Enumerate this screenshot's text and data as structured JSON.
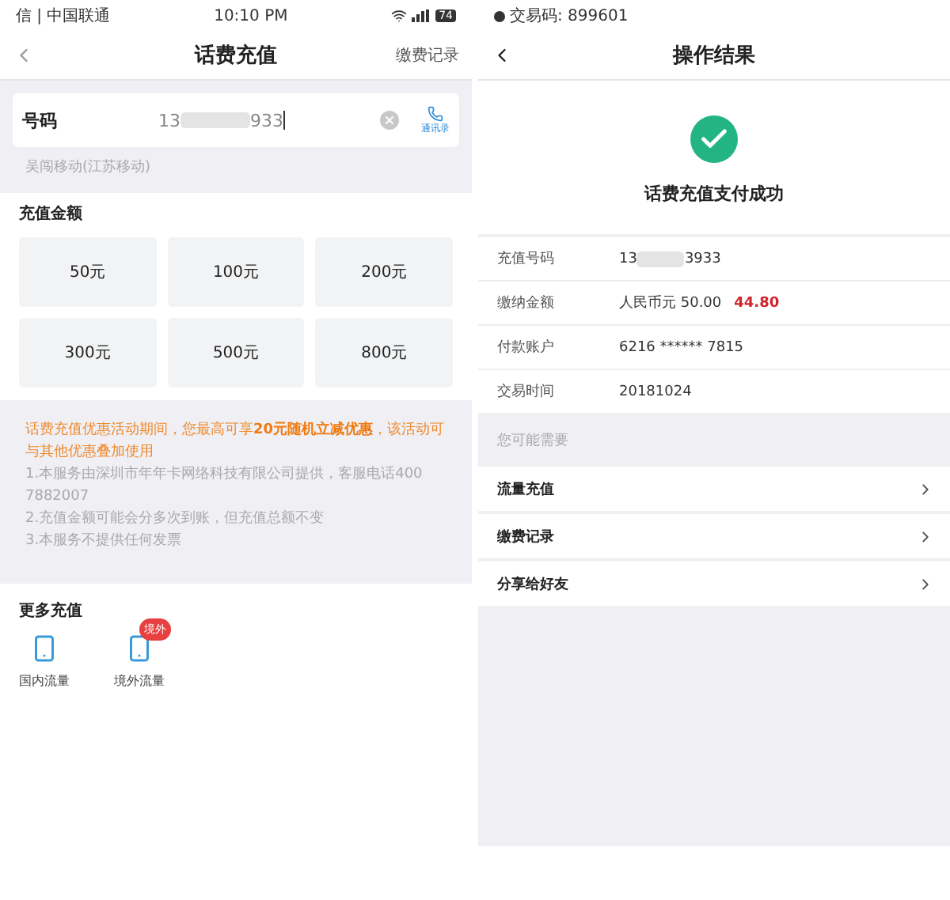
{
  "recharge": {
    "status_bar": {
      "carrier": "信 | 中国联通",
      "time": "10:10 PM",
      "battery": "74"
    },
    "nav": {
      "title": "话费充值",
      "action": "缴费记录"
    },
    "phone": {
      "label": "号码",
      "value_start": "13",
      "value_end": "933",
      "contacts": "通讯录"
    },
    "carrier_info": "吴闯移动(江苏移动)",
    "amount_section": {
      "title": "充值金额",
      "options": [
        {
          "label": "50元"
        },
        {
          "label": "100元"
        },
        {
          "label": "200元"
        },
        {
          "label": "300元"
        },
        {
          "label": "500元"
        },
        {
          "label": "800元"
        }
      ]
    },
    "notice": {
      "promo": "话费充值优惠活动期间，您最高可享**20元随机立减优惠**，该活动可与其他优惠叠加使用",
      "lines": [
        "1.本服务由深圳市年年卡网络科技有限公司提供，客服电话400 7882007",
        "2.充值金额可能会分多次到账，但充值总额不变",
        "3.本服务不提供任何发票"
      ]
    },
    "more": {
      "title": "更多充值",
      "items": [
        {
          "label": "国内流量"
        },
        {
          "label": "境外流量",
          "badge": "境外"
        }
      ]
    }
  },
  "result": {
    "status_bar": {
      "text": "交易码: 899601"
    },
    "nav": {
      "title": "操作结果"
    },
    "success": {
      "message": "话费充值支付成功"
    },
    "details": [
      {
        "label": "充值号码",
        "kind": "masked",
        "value_start": "13",
        "value_end": "3933"
      },
      {
        "label": "缴纳金额",
        "kind": "amount",
        "value": "人民币元 50.00",
        "paid": "44.80"
      },
      {
        "label": "付款账户",
        "kind": "plain",
        "value": "6216 ****** 7815"
      },
      {
        "label": "交易时间",
        "kind": "plain",
        "value": "20181024"
      }
    ],
    "suggest_title": "您可能需要",
    "links": [
      {
        "label": "流量充值"
      },
      {
        "label": "缴费记录"
      },
      {
        "label": "分享给好友"
      }
    ]
  }
}
